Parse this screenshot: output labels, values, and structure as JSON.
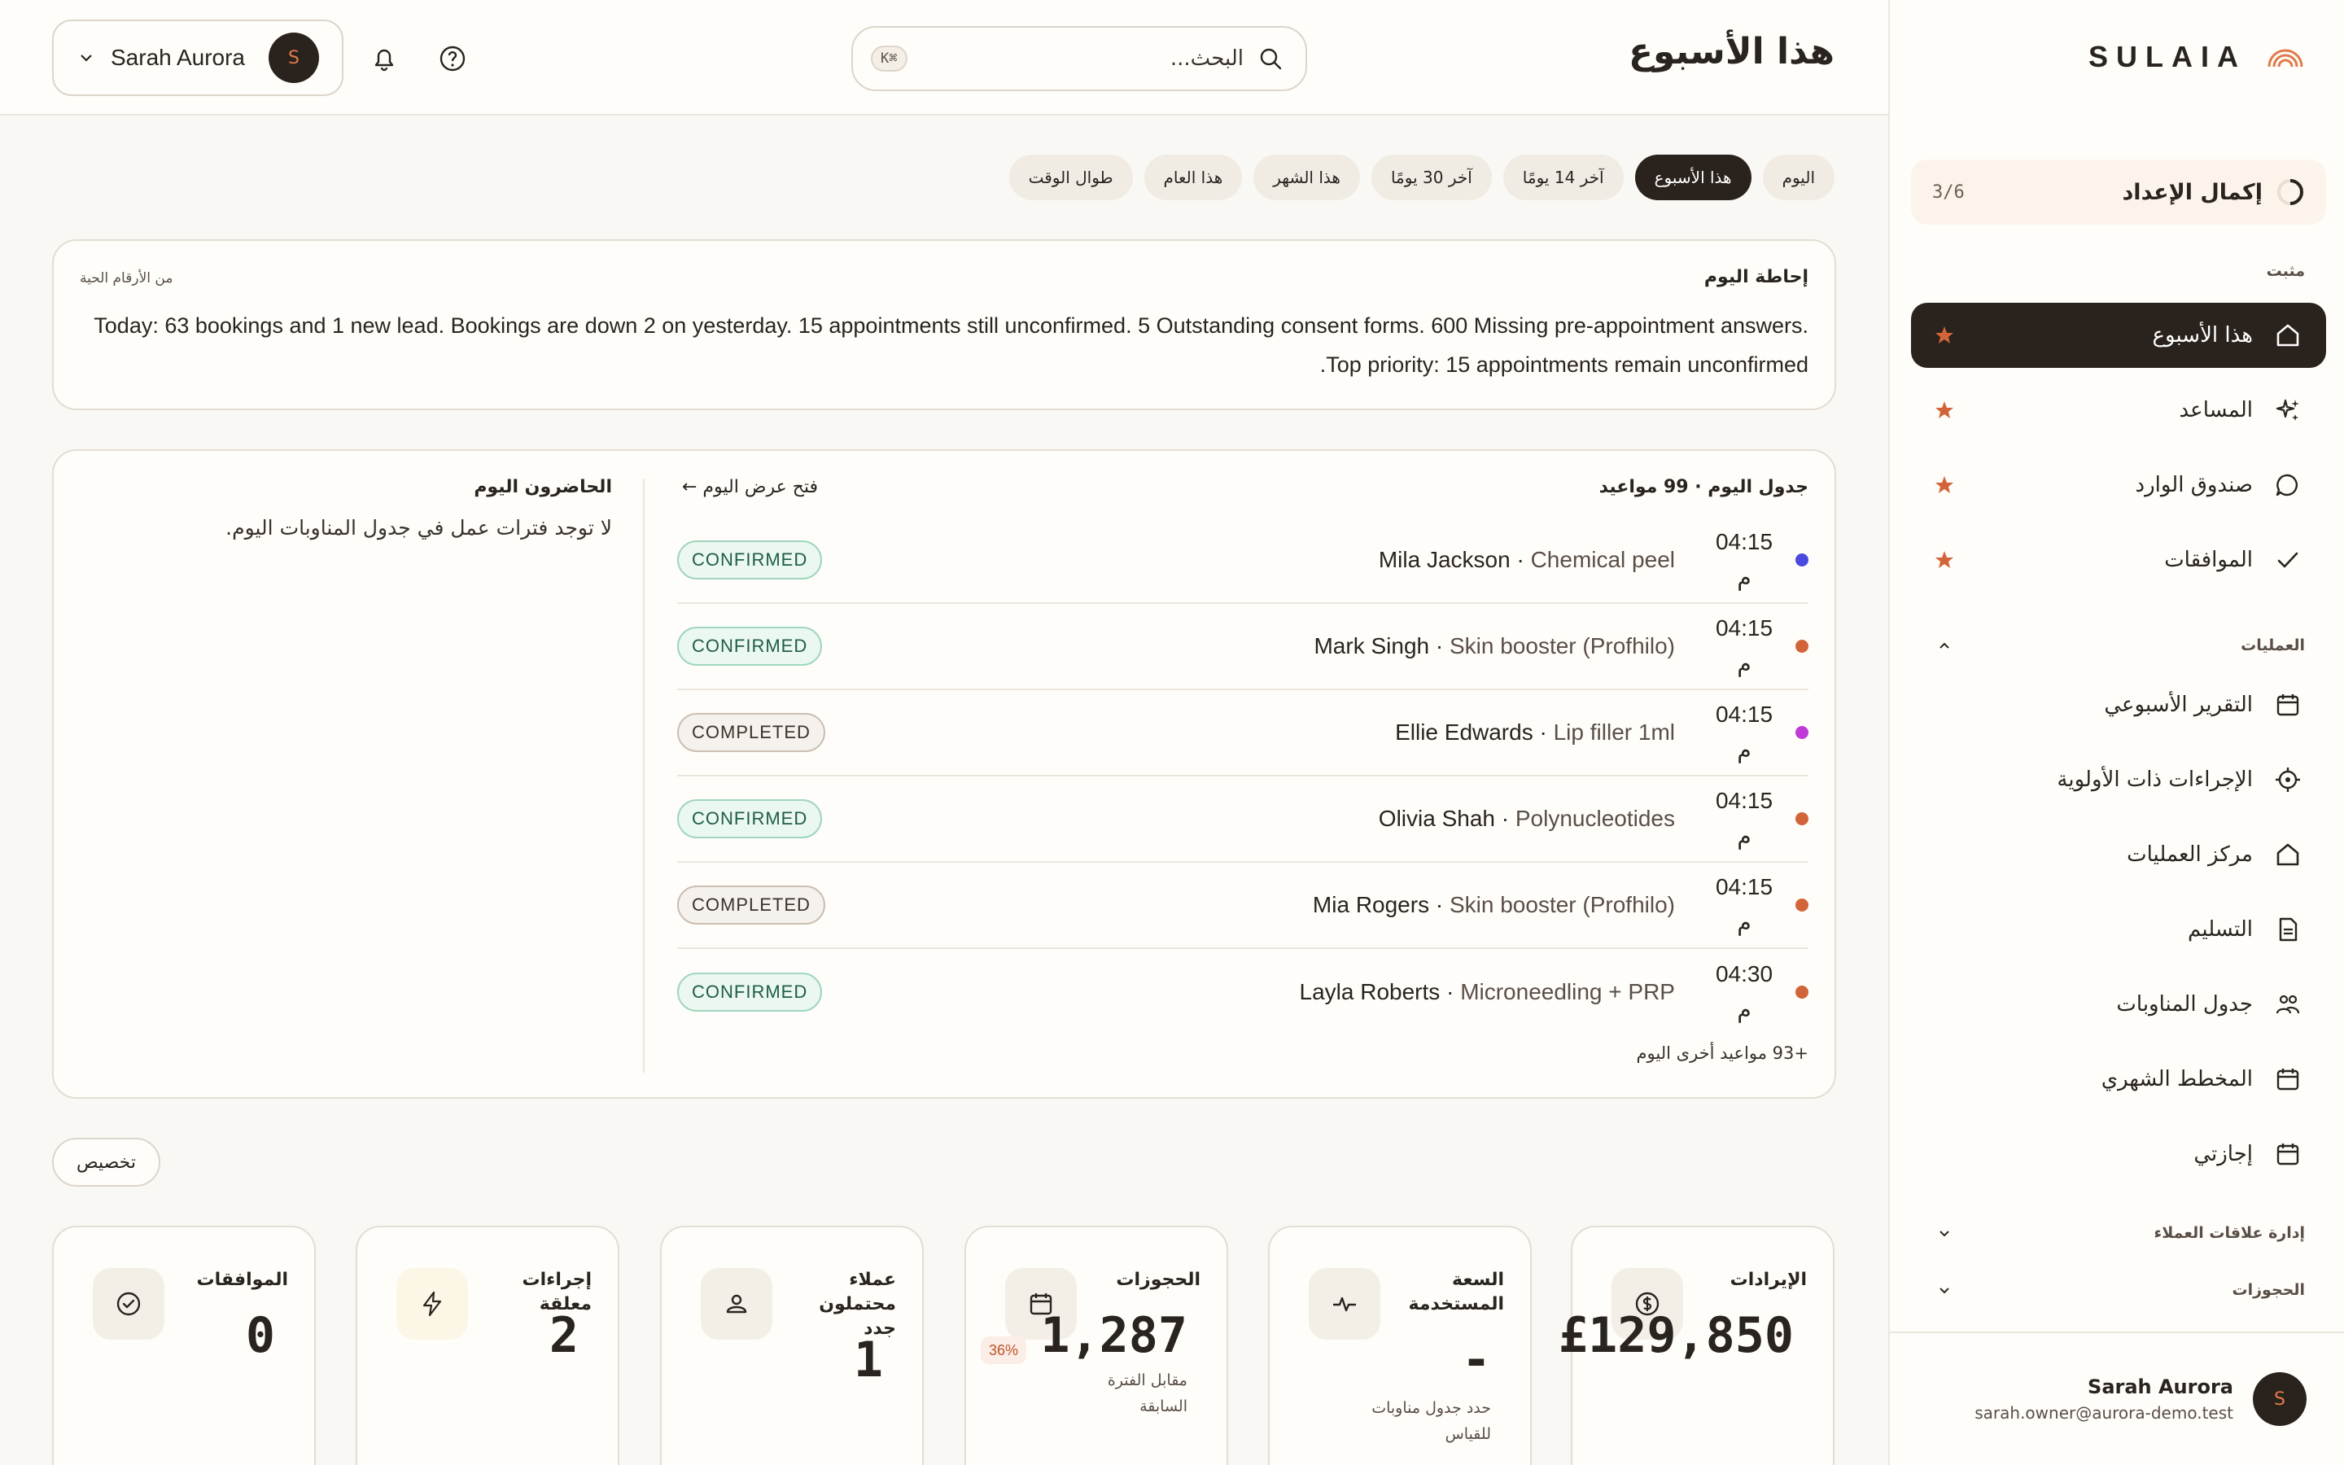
{
  "brand": {
    "name": "SULAIA",
    "logo_icon": "rainbow-arcs-logo",
    "accent": "#e07a4a"
  },
  "setup": {
    "label": "إكمال الإعداد",
    "progress": "3/6",
    "fraction": 0.5
  },
  "sidebar": {
    "pinned_label": "مثبت",
    "pinned": [
      {
        "label": "هذا الأسبوع",
        "icon": "home-icon",
        "active": true
      },
      {
        "label": "المساعد",
        "icon": "sparkles-icon"
      },
      {
        "label": "صندوق الوارد",
        "icon": "chat-bubble-icon"
      },
      {
        "label": "الموافقات",
        "icon": "check-icon"
      }
    ],
    "operations_label": "العمليات",
    "operations": [
      {
        "label": "التقرير الأسبوعي",
        "icon": "calendar-icon"
      },
      {
        "label": "الإجراءات ذات الأولوية",
        "icon": "target-icon"
      },
      {
        "label": "مركز العمليات",
        "icon": "home-icon"
      },
      {
        "label": "التسليم",
        "icon": "document-icon"
      },
      {
        "label": "جدول المناوبات",
        "icon": "people-icon"
      },
      {
        "label": "المخطط الشهري",
        "icon": "calendar-icon"
      },
      {
        "label": "إجازتي",
        "icon": "calendar-icon"
      }
    ],
    "crm_label": "إدارة علاقات العملاء",
    "bookings_label": "الحجوزات",
    "user": {
      "name": "Sarah Aurora",
      "email": "sarah.owner@aurora-demo.test",
      "initial": "S"
    }
  },
  "header": {
    "title": "هذا الأسبوع",
    "search_placeholder": "البحث...",
    "search_shortcut": "⌘K",
    "user_name": "Sarah Aurora",
    "user_initial": "S"
  },
  "filters": [
    {
      "label": "اليوم"
    },
    {
      "label": "هذا الأسبوع",
      "active": true
    },
    {
      "label": "آخر 14 يومًا"
    },
    {
      "label": "آخر 30 يومًا"
    },
    {
      "label": "هذا الشهر"
    },
    {
      "label": "هذا العام"
    },
    {
      "label": "طوال الوقت"
    }
  ],
  "briefing": {
    "title": "إحاطة اليوم",
    "source": "من الأرقام الحية",
    "text": "Today: 63 bookings and 1 new lead. Bookings are down 2 on yesterday. 15 appointments still unconfirmed. 5 Outstanding consent forms. 600 Missing pre-appointment answers. Top priority: 15 appointments remain unconfirmed."
  },
  "schedule": {
    "title": "جدول اليوم · 99 مواعيد",
    "open_link": "فتح عرض اليوم ←",
    "more": "+93 مواعيد أخرى اليوم",
    "appointments": [
      {
        "time": "04:15",
        "period": "م",
        "name": "Mila Jackson",
        "service": "Chemical peel",
        "status": "CONFIRMED",
        "kind": "confirmed",
        "dot": "#4a4ae0"
      },
      {
        "time": "04:15",
        "period": "م",
        "name": "Mark Singh",
        "service": "Skin booster (Profhilo)",
        "status": "CONFIRMED",
        "kind": "confirmed",
        "dot": "#d2643a"
      },
      {
        "time": "04:15",
        "period": "م",
        "name": "Ellie Edwards",
        "service": "Lip filler 1ml",
        "status": "COMPLETED",
        "kind": "completed",
        "dot": "#c03ad8"
      },
      {
        "time": "04:15",
        "period": "م",
        "name": "Olivia Shah",
        "service": "Polynucleotides",
        "status": "CONFIRMED",
        "kind": "confirmed",
        "dot": "#d2643a"
      },
      {
        "time": "04:15",
        "period": "م",
        "name": "Mia Rogers",
        "service": "Skin booster (Profhilo)",
        "status": "COMPLETED",
        "kind": "completed",
        "dot": "#d2643a"
      },
      {
        "time": "04:30",
        "period": "م",
        "name": "Layla Roberts",
        "service": "Microneedling + PRP",
        "status": "CONFIRMED",
        "kind": "confirmed",
        "dot": "#d2643a"
      }
    ],
    "staff_title": "الحاضرون اليوم",
    "staff_empty": "لا توجد فترات عمل في جدول المناوبات اليوم."
  },
  "customize_label": "تخصيص",
  "kpis": {
    "revenue": {
      "label": "الإيرادات",
      "value": "£129,850",
      "icon": "dollar-circle-icon"
    },
    "capacity": {
      "label": "السعة المستخدمة",
      "value": "-",
      "sub": "حدد جدول مناوبات للقياس",
      "icon": "pulse-icon"
    },
    "bookings": {
      "label": "الحجوزات",
      "value": "1,287",
      "sub": "مقابل الفترة السابقة",
      "delta": "36%",
      "icon": "calendar-icon"
    },
    "leads": {
      "label": "عملاء محتملون جدد",
      "value": "1",
      "icon": "person-icon"
    },
    "pending": {
      "label": "إجراءات معلقة",
      "value": "2",
      "icon": "bolt-icon"
    },
    "approvals": {
      "label": "الموافقات",
      "value": "0",
      "icon": "check-circle-icon"
    }
  }
}
